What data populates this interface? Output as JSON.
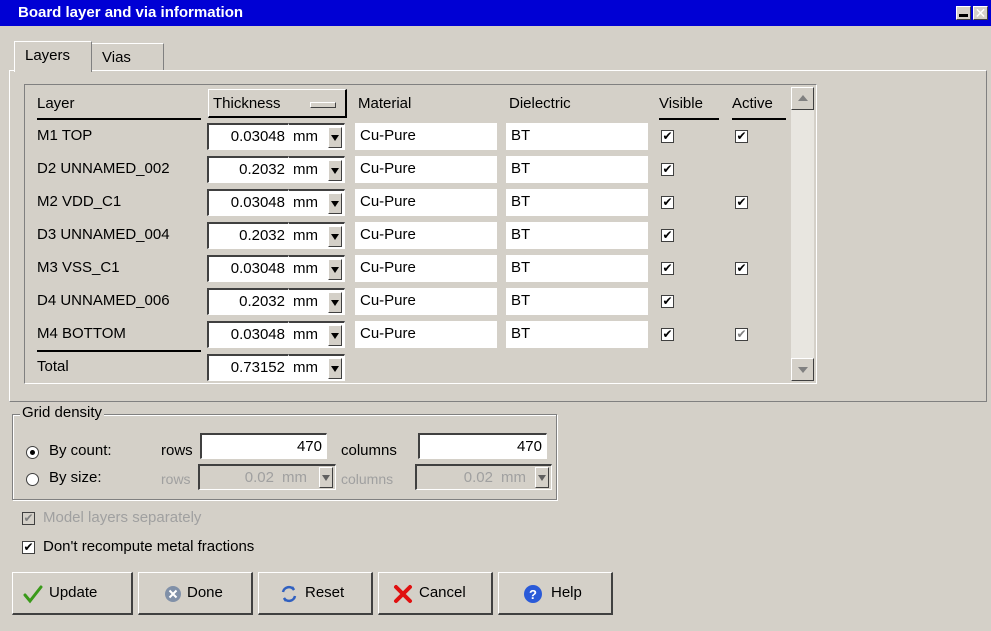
{
  "window": {
    "title": "Board layer and via information"
  },
  "tabs": [
    {
      "label": "Layers"
    },
    {
      "label": "Vias"
    }
  ],
  "layers_grid": {
    "headers": {
      "layer": "Layer",
      "thickness": "Thickness",
      "material": "Material",
      "dielectric": "Dielectric",
      "visible": "Visible",
      "active": "Active"
    },
    "rows": [
      {
        "layer": "M1 TOP",
        "thickness": "0.03048",
        "unit": "mm",
        "material": "Cu-Pure",
        "dielectric": "BT",
        "visible": "✔",
        "active": "✔",
        "active_dim": false
      },
      {
        "layer": "D2 UNNAMED_002",
        "thickness": "0.2032",
        "unit": "mm",
        "material": "Cu-Pure",
        "dielectric": "BT",
        "visible": "✔",
        "active": "",
        "active_dim": false
      },
      {
        "layer": "M2 VDD_C1",
        "thickness": "0.03048",
        "unit": "mm",
        "material": "Cu-Pure",
        "dielectric": "BT",
        "visible": "✔",
        "active": "✔",
        "active_dim": false
      },
      {
        "layer": "D3 UNNAMED_004",
        "thickness": "0.2032",
        "unit": "mm",
        "material": "Cu-Pure",
        "dielectric": "BT",
        "visible": "✔",
        "active": "",
        "active_dim": false
      },
      {
        "layer": "M3 VSS_C1",
        "thickness": "0.03048",
        "unit": "mm",
        "material": "Cu-Pure",
        "dielectric": "BT",
        "visible": "✔",
        "active": "✔",
        "active_dim": false
      },
      {
        "layer": "D4 UNNAMED_006",
        "thickness": "0.2032",
        "unit": "mm",
        "material": "Cu-Pure",
        "dielectric": "BT",
        "visible": "✔",
        "active": "",
        "active_dim": false
      },
      {
        "layer": "M4 BOTTOM",
        "thickness": "0.03048",
        "unit": "mm",
        "material": "Cu-Pure",
        "dielectric": "BT",
        "visible": "✔",
        "active": "✔",
        "active_dim": true
      }
    ],
    "total": {
      "label": "Total",
      "thickness": "0.73152",
      "unit": "mm"
    }
  },
  "grid_density": {
    "legend": "Grid density",
    "by_count": {
      "label": "By count:",
      "rows_label": "rows",
      "rows": "470",
      "columns_label": "columns",
      "columns": "470"
    },
    "by_size": {
      "label": "By size:",
      "rows_label": "rows",
      "rows": "0.02",
      "rows_unit": "mm",
      "columns_label": "columns",
      "columns": "0.02",
      "columns_unit": "mm"
    }
  },
  "options": {
    "model_layers_separately": {
      "label": "Model layers separately",
      "mark": "✔"
    },
    "dont_recompute": {
      "label": "Don't recompute metal fractions",
      "mark": "✔"
    }
  },
  "buttons": {
    "update": "Update",
    "done": "Done",
    "reset": "Reset",
    "cancel": "Cancel",
    "help": "Help"
  },
  "icons": {
    "update": "checkmark-icon",
    "done": "x-circle-icon",
    "reset": "recycle-icon",
    "cancel": "red-x-icon",
    "help": "question-icon"
  },
  "colors": {
    "titlebar": "#0000d4",
    "window_bg": "#d4d0c8"
  }
}
